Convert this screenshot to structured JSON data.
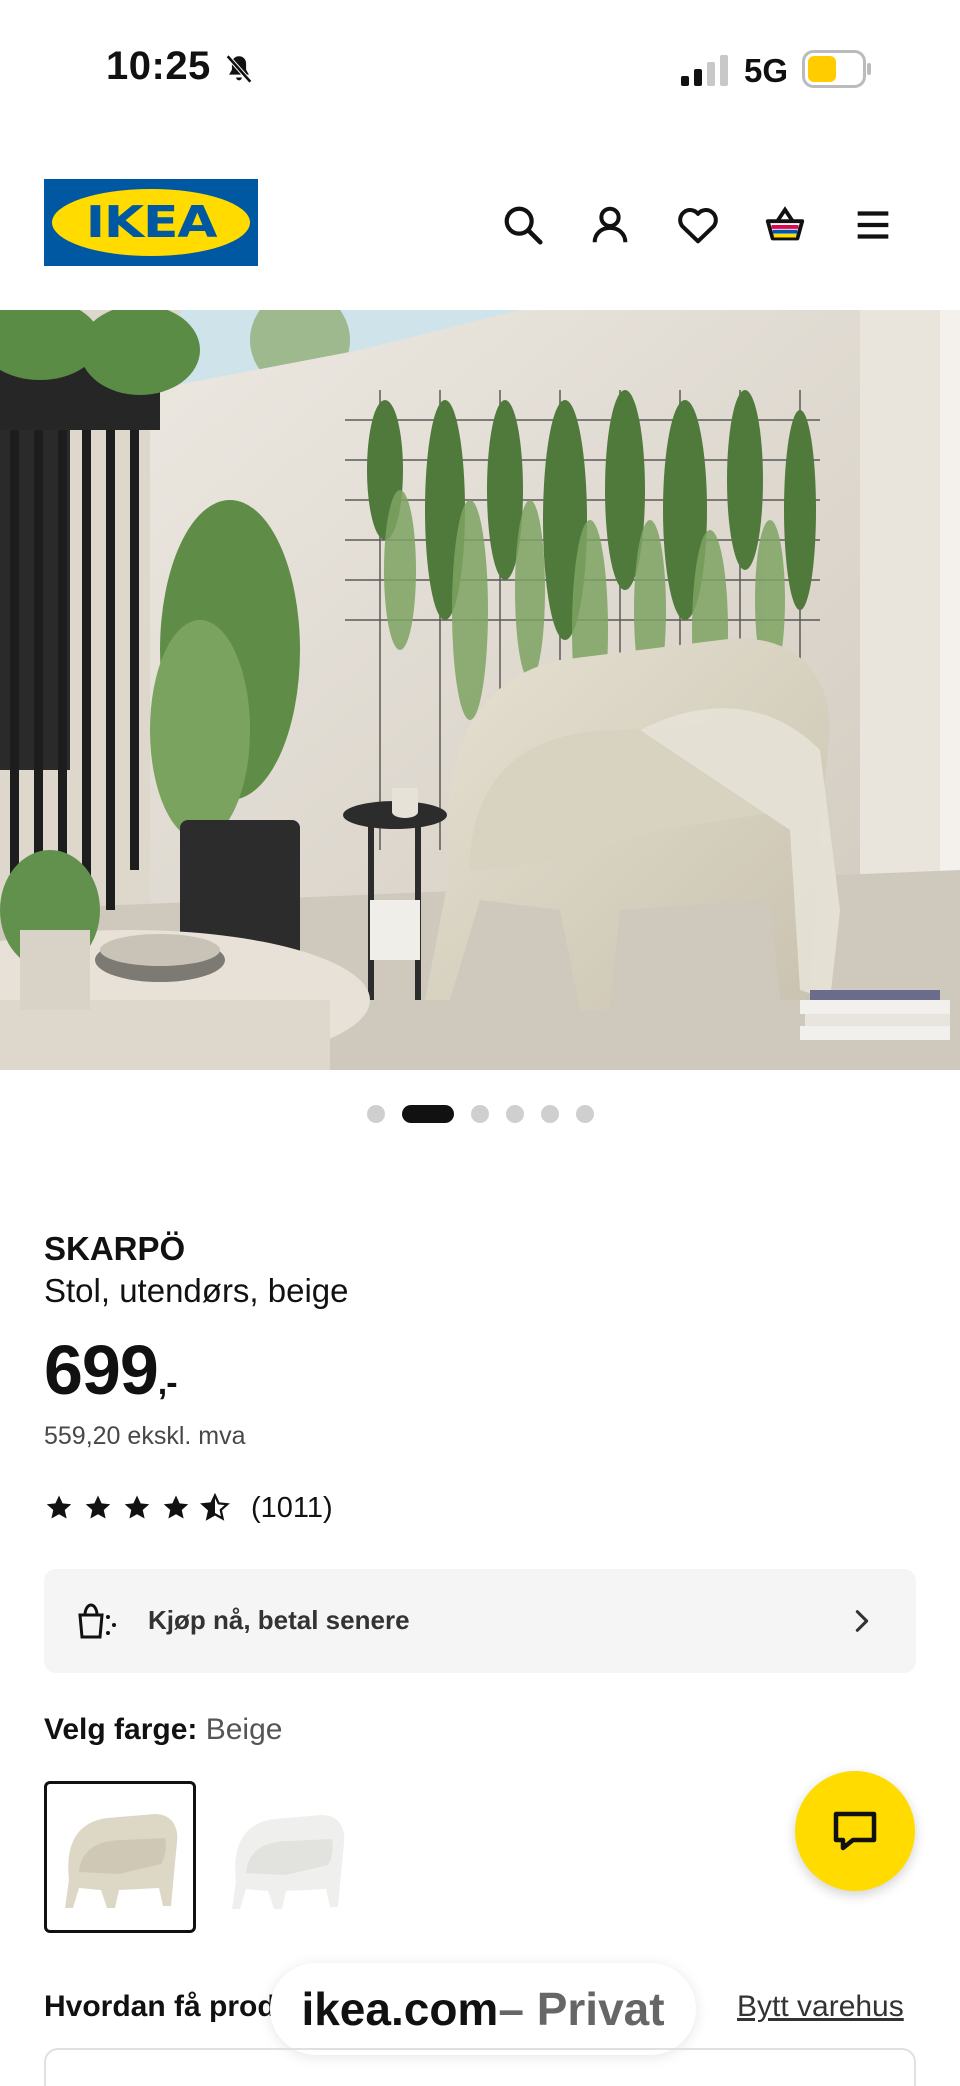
{
  "status_bar": {
    "time": "10:25",
    "network": "5G",
    "icons": [
      "bell-slash-icon",
      "signal-icon",
      "battery-icon"
    ],
    "battery_color": "#ffcc00"
  },
  "header": {
    "logo_text": "IKEA",
    "icons": [
      "search-icon",
      "account-icon",
      "heart-icon",
      "basket-icon",
      "menu-icon"
    ],
    "colors": {
      "brand_blue": "#0058a3",
      "brand_yellow": "#ffdb00"
    }
  },
  "gallery": {
    "image_count": 6,
    "active_index": 1
  },
  "product": {
    "name": "SKARPÖ",
    "description": "Stol, utendørs, beige",
    "price": "699",
    "price_suffix": ",-",
    "price_excl_vat": "559,20 ekskl. mva",
    "rating_stars": 4.5,
    "rating_count": "(1011)"
  },
  "bnpl": {
    "label": "Kjøp nå, betal senere",
    "icon": "shopping-bag-icon"
  },
  "color_picker": {
    "label": "Velg farge:",
    "selected": "Beige",
    "options": [
      {
        "name": "beige",
        "color": "#ddd7c6"
      },
      {
        "name": "white",
        "color": "#eeeeec"
      }
    ]
  },
  "delivery": {
    "label": "Hvordan få produktet",
    "store_link": "Bytt varehus"
  },
  "browser": {
    "host": "ikea.com",
    "mode": " – Privat"
  },
  "chat": {
    "icon": "chat-icon",
    "color": "#ffdb00"
  }
}
